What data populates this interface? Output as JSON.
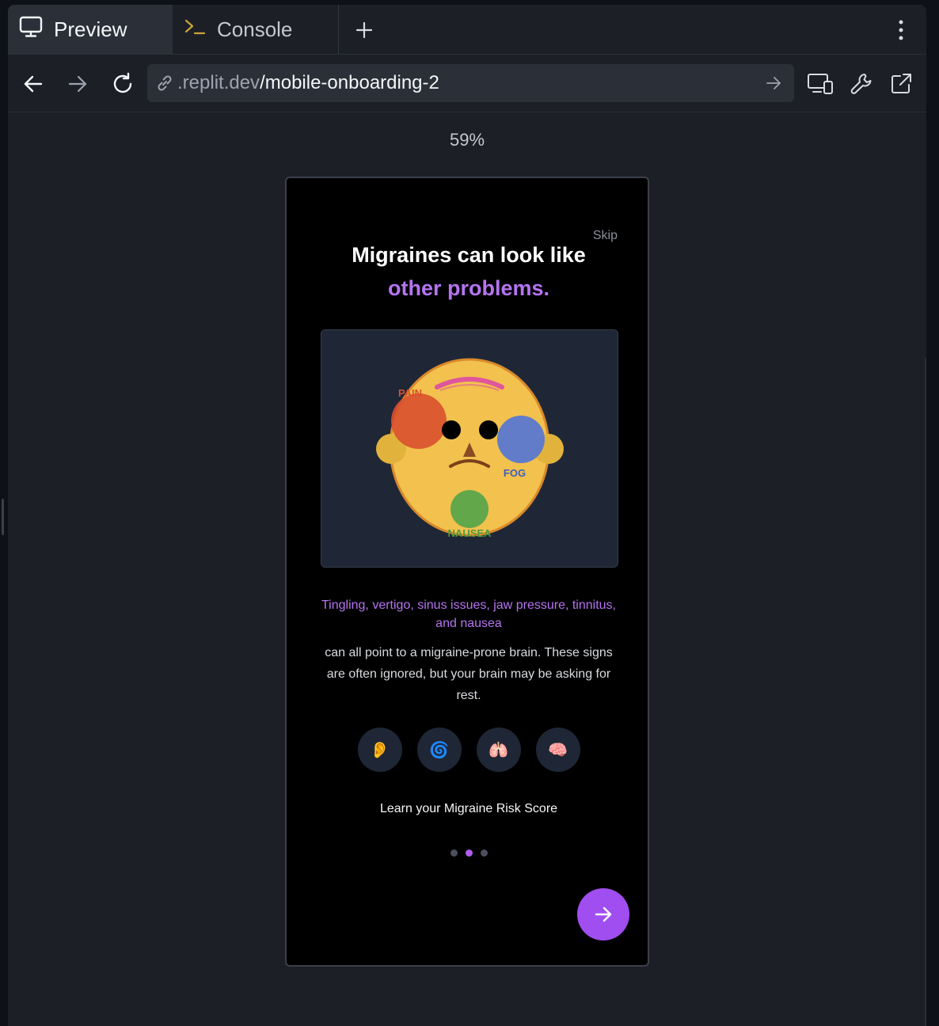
{
  "tabs": [
    {
      "label": "Preview",
      "icon": "monitor-icon"
    },
    {
      "label": "Console",
      "icon": "terminal-icon"
    }
  ],
  "toolbar": {
    "url_host": ".replit.dev",
    "url_path": "/mobile-onboarding-2"
  },
  "zoom": "59%",
  "app": {
    "skip": "Skip",
    "title_line1": "Migraines can look like",
    "title_line2": "other problems.",
    "face_labels": {
      "pain": "PAIN",
      "fog": "FOG",
      "nausea": "NAUSEA"
    },
    "subhead": "Tingling, vertigo, sinus issues, jaw pressure, tinnitus, and nausea",
    "body": "can all point to a migraine-prone brain. These signs are often ignored, but your brain may be asking for rest.",
    "symptom_icons": [
      "👂",
      "🌀",
      "🫁",
      "🧠"
    ],
    "cta": "Learn your Migraine Risk Score",
    "page_index": 1,
    "page_count": 3
  },
  "colors": {
    "accent": "#b574f0",
    "button": "#a04ef0",
    "face": "#f2c14e",
    "pain": "#d9502f",
    "fog": "#5a78d0",
    "nausea": "#62a74a"
  }
}
